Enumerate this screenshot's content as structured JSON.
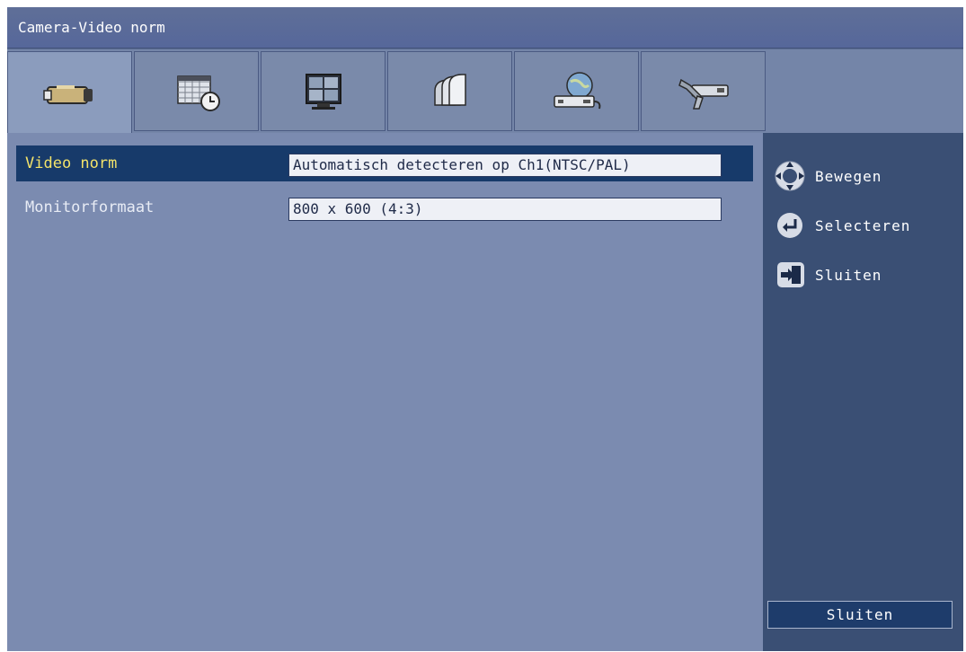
{
  "window": {
    "title": "Camera-Video norm"
  },
  "tabs": [
    {
      "icon": "camera-icon"
    },
    {
      "icon": "schedule-calendar-icon"
    },
    {
      "icon": "monitor-display-icon"
    },
    {
      "icon": "archive-storage-icon"
    },
    {
      "icon": "network-globe-icon"
    },
    {
      "icon": "tools-wrench-icon"
    }
  ],
  "settings": [
    {
      "label": "Video norm",
      "value": "Automatisch detecteren op Ch1(NTSC/PAL)",
      "selected": true
    },
    {
      "label": "Monitorformaat",
      "value": "800 x 600 (4:3)",
      "selected": false
    }
  ],
  "sidebar": {
    "hints": [
      {
        "icon": "navigate-arrows-icon",
        "label": "Bewegen"
      },
      {
        "icon": "enter-select-icon",
        "label": "Selecteren"
      },
      {
        "icon": "exit-close-icon",
        "label": "Sluiten"
      }
    ],
    "close_button_label": "Sluiten"
  },
  "colors": {
    "selected_label": "#f3e36a",
    "selected_row": "#173a6a",
    "background": "#7b8bb0"
  }
}
